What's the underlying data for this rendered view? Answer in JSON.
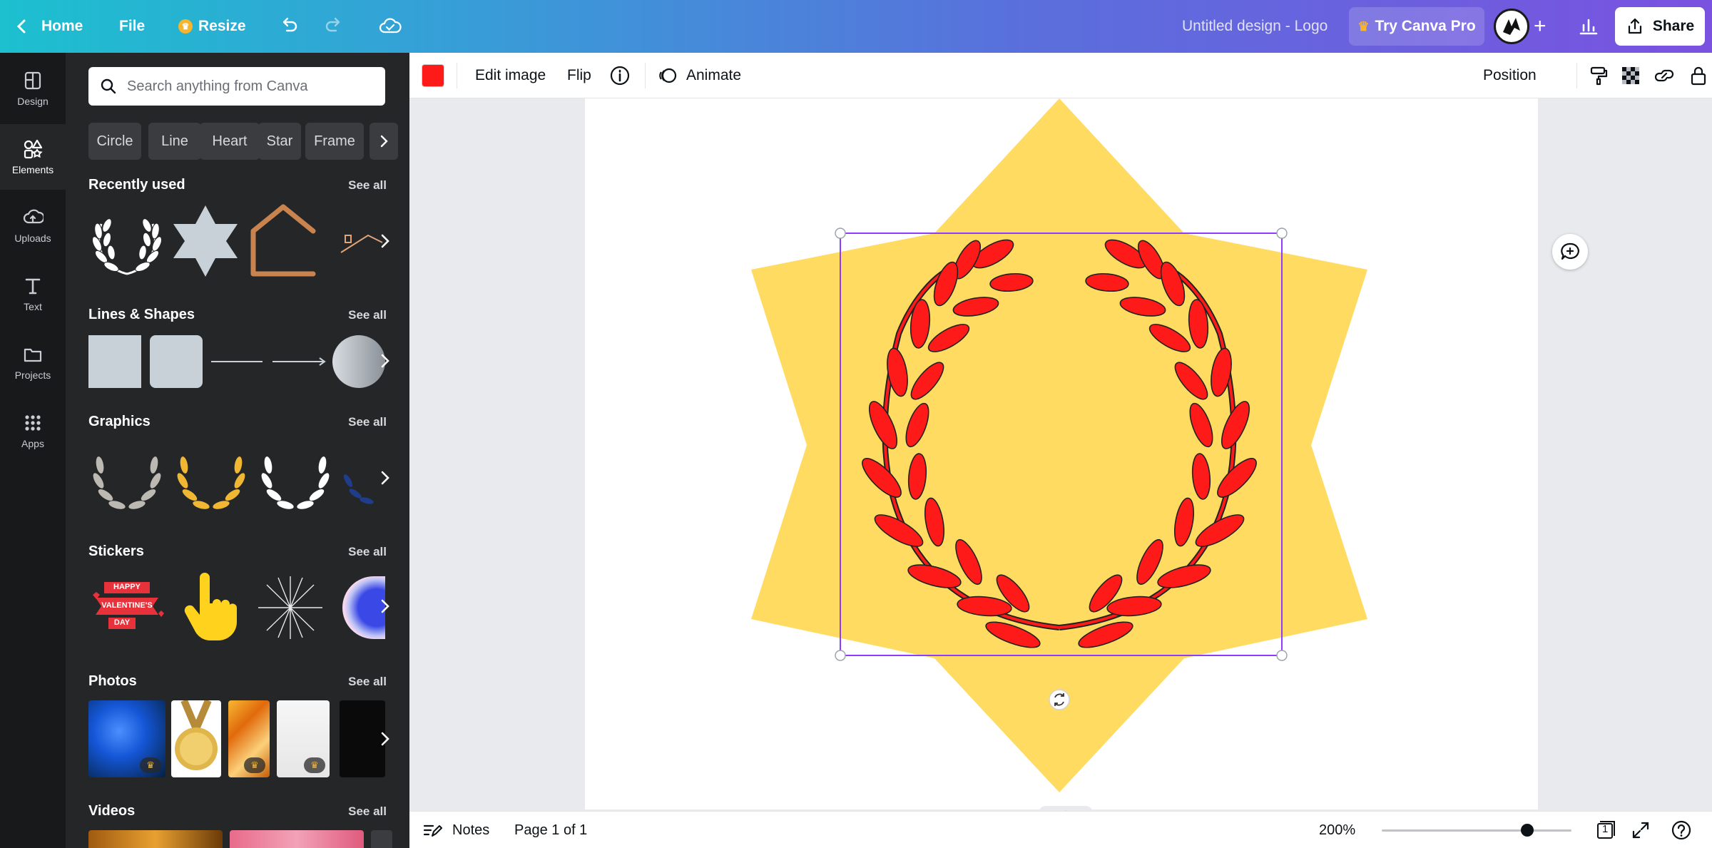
{
  "topbar": {
    "home_label": "Home",
    "file_label": "File",
    "resize_label": "Resize",
    "design_title": "Untitled design - Logo",
    "try_pro_label": "Try Canva Pro",
    "share_label": "Share"
  },
  "rail": {
    "items": [
      {
        "label": "Design",
        "icon": "design-icon"
      },
      {
        "label": "Elements",
        "icon": "elements-icon"
      },
      {
        "label": "Uploads",
        "icon": "uploads-icon"
      },
      {
        "label": "Text",
        "icon": "text-icon"
      },
      {
        "label": "Projects",
        "icon": "projects-icon"
      },
      {
        "label": "Apps",
        "icon": "apps-icon"
      }
    ]
  },
  "panel": {
    "search_placeholder": "Search anything from Canva",
    "chips": [
      "Circle",
      "Line",
      "Heart",
      "Star",
      "Frame"
    ],
    "see_all": "See all",
    "sections": {
      "recently_used": "Recently used",
      "lines_shapes": "Lines & Shapes",
      "graphics": "Graphics",
      "stickers": "Stickers",
      "photos": "Photos",
      "videos": "Videos"
    },
    "sticker_text": [
      "HAPPY",
      "VALENTINE'S",
      "DAY"
    ]
  },
  "toolbar": {
    "color": "#ff1a1a",
    "edit_image_label": "Edit image",
    "flip_label": "Flip",
    "animate_label": "Animate",
    "position_label": "Position"
  },
  "canvas": {
    "star_color": "#ffdb61",
    "wreath_color": "#ff1a1a",
    "selection_color": "#8b3dff"
  },
  "bottombar": {
    "notes_label": "Notes",
    "page_label": "Page 1 of 1",
    "zoom_label": "200%",
    "zoom_percent": 200,
    "page_count": "1"
  }
}
